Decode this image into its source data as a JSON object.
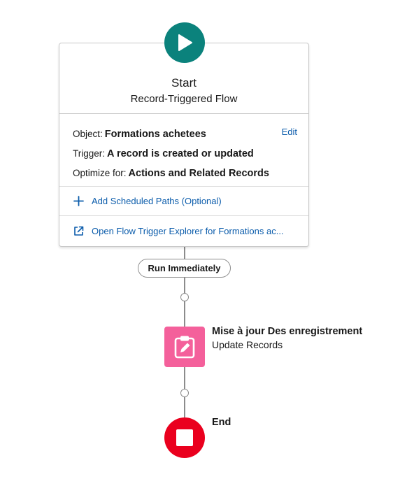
{
  "colors": {
    "start": "#0b827c",
    "update": "#f4609b",
    "end": "#ea001e",
    "link": "#0b5cab",
    "connector": "#8c8c8c"
  },
  "start": {
    "icon": "play-icon",
    "title": "Start",
    "subtitle": "Record-Triggered Flow",
    "edit_label": "Edit",
    "details": [
      {
        "label": "Object:",
        "value": "Formations achetees"
      },
      {
        "label": "Trigger:",
        "value": "A record is created or updated"
      },
      {
        "label": "Optimize for:",
        "value": "Actions and Related Records"
      }
    ],
    "actions": {
      "add_paths": {
        "icon": "plus-icon",
        "label": "Add Scheduled Paths (Optional)"
      },
      "open_explorer": {
        "icon": "external-link-icon",
        "label": "Open Flow Trigger Explorer for Formations ac..."
      }
    }
  },
  "path": {
    "label": "Run Immediately"
  },
  "update_element": {
    "icon": "clipboard-edit-icon",
    "title": "Mise à jour Des enregistrement",
    "type": "Update Records"
  },
  "end_element": {
    "icon": "stop-icon",
    "label": "End"
  }
}
